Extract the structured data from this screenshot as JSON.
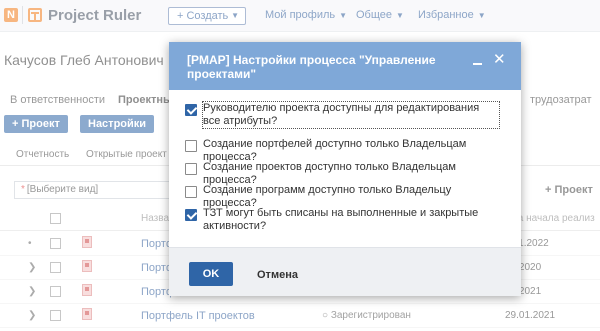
{
  "topbar": {
    "logo_letter": "N",
    "app_title": "Project Ruler",
    "create_label": "+ Создать",
    "nav": [
      "Мой профиль",
      "Общее",
      "Избранное"
    ]
  },
  "page": {
    "user_name": "Качусов Глеб Антонович",
    "tabs": [
      "В ответственности",
      "Проектный",
      "трудозатрат"
    ],
    "add_project_label": "+ Проект",
    "settings_label": "Настройки",
    "subtabs": [
      "Отчетность",
      "Открытые проект"
    ],
    "filter_placeholder": "[Выберите вид]",
    "filter_required_mark": "*",
    "right_project_label": "+ Проект",
    "columns": [
      "Назва",
      "ата начала реализ"
    ],
    "rows": [
      {
        "name": "Портфе",
        "status": "",
        "date": "9.11.2022"
      },
      {
        "name": "Портфе",
        "status": "",
        "date": "03.2020"
      },
      {
        "name": "Портфе",
        "status": "",
        "date": "03.2021"
      },
      {
        "name": "Портфель IT проектов",
        "status": "○ Зарегистрирован",
        "date": "29.01.2021"
      }
    ]
  },
  "modal": {
    "title": "[PMAP] Настройки процесса \"Управление проектами\"",
    "options": [
      {
        "label": "Руководителю проекта доступны для редактирования все атрибуты?",
        "checked": true
      },
      {
        "label": "Создание портфелей доступно только Владельцам процесса?",
        "checked": false
      },
      {
        "label": "Создание проектов доступно только Владельцам процесса?",
        "checked": false
      },
      {
        "label": "Создание программ доступно только Владельцу процесса?",
        "checked": false
      },
      {
        "label": "ТЗТ могут быть списаны на выполненные и закрытые активности?",
        "checked": true
      }
    ],
    "ok_label": "OK",
    "cancel_label": "Отмена"
  }
}
